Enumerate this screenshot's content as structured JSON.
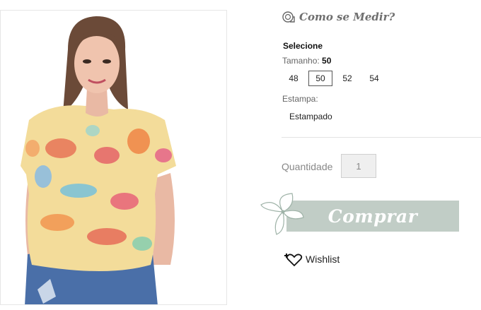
{
  "product": {
    "measure_link": "Como se Medir?",
    "select_title": "Selecione",
    "size_label": "Tamanho:",
    "size_selected": "50",
    "sizes": [
      "48",
      "50",
      "52",
      "54"
    ],
    "print_label": "Estampa:",
    "print_option": "Estampado",
    "quantity_label": "Quantidade",
    "quantity_value": "1",
    "buy_label": "Comprar",
    "wishlist_label": "Wishlist"
  },
  "colors": {
    "buy_button": "#c1cdc6",
    "measure_text": "#6f6f6f"
  },
  "icons": {
    "measure": "tape-measure-icon",
    "buy": "butterfly-flower-icon",
    "wishlist": "heart-plus-icon"
  }
}
